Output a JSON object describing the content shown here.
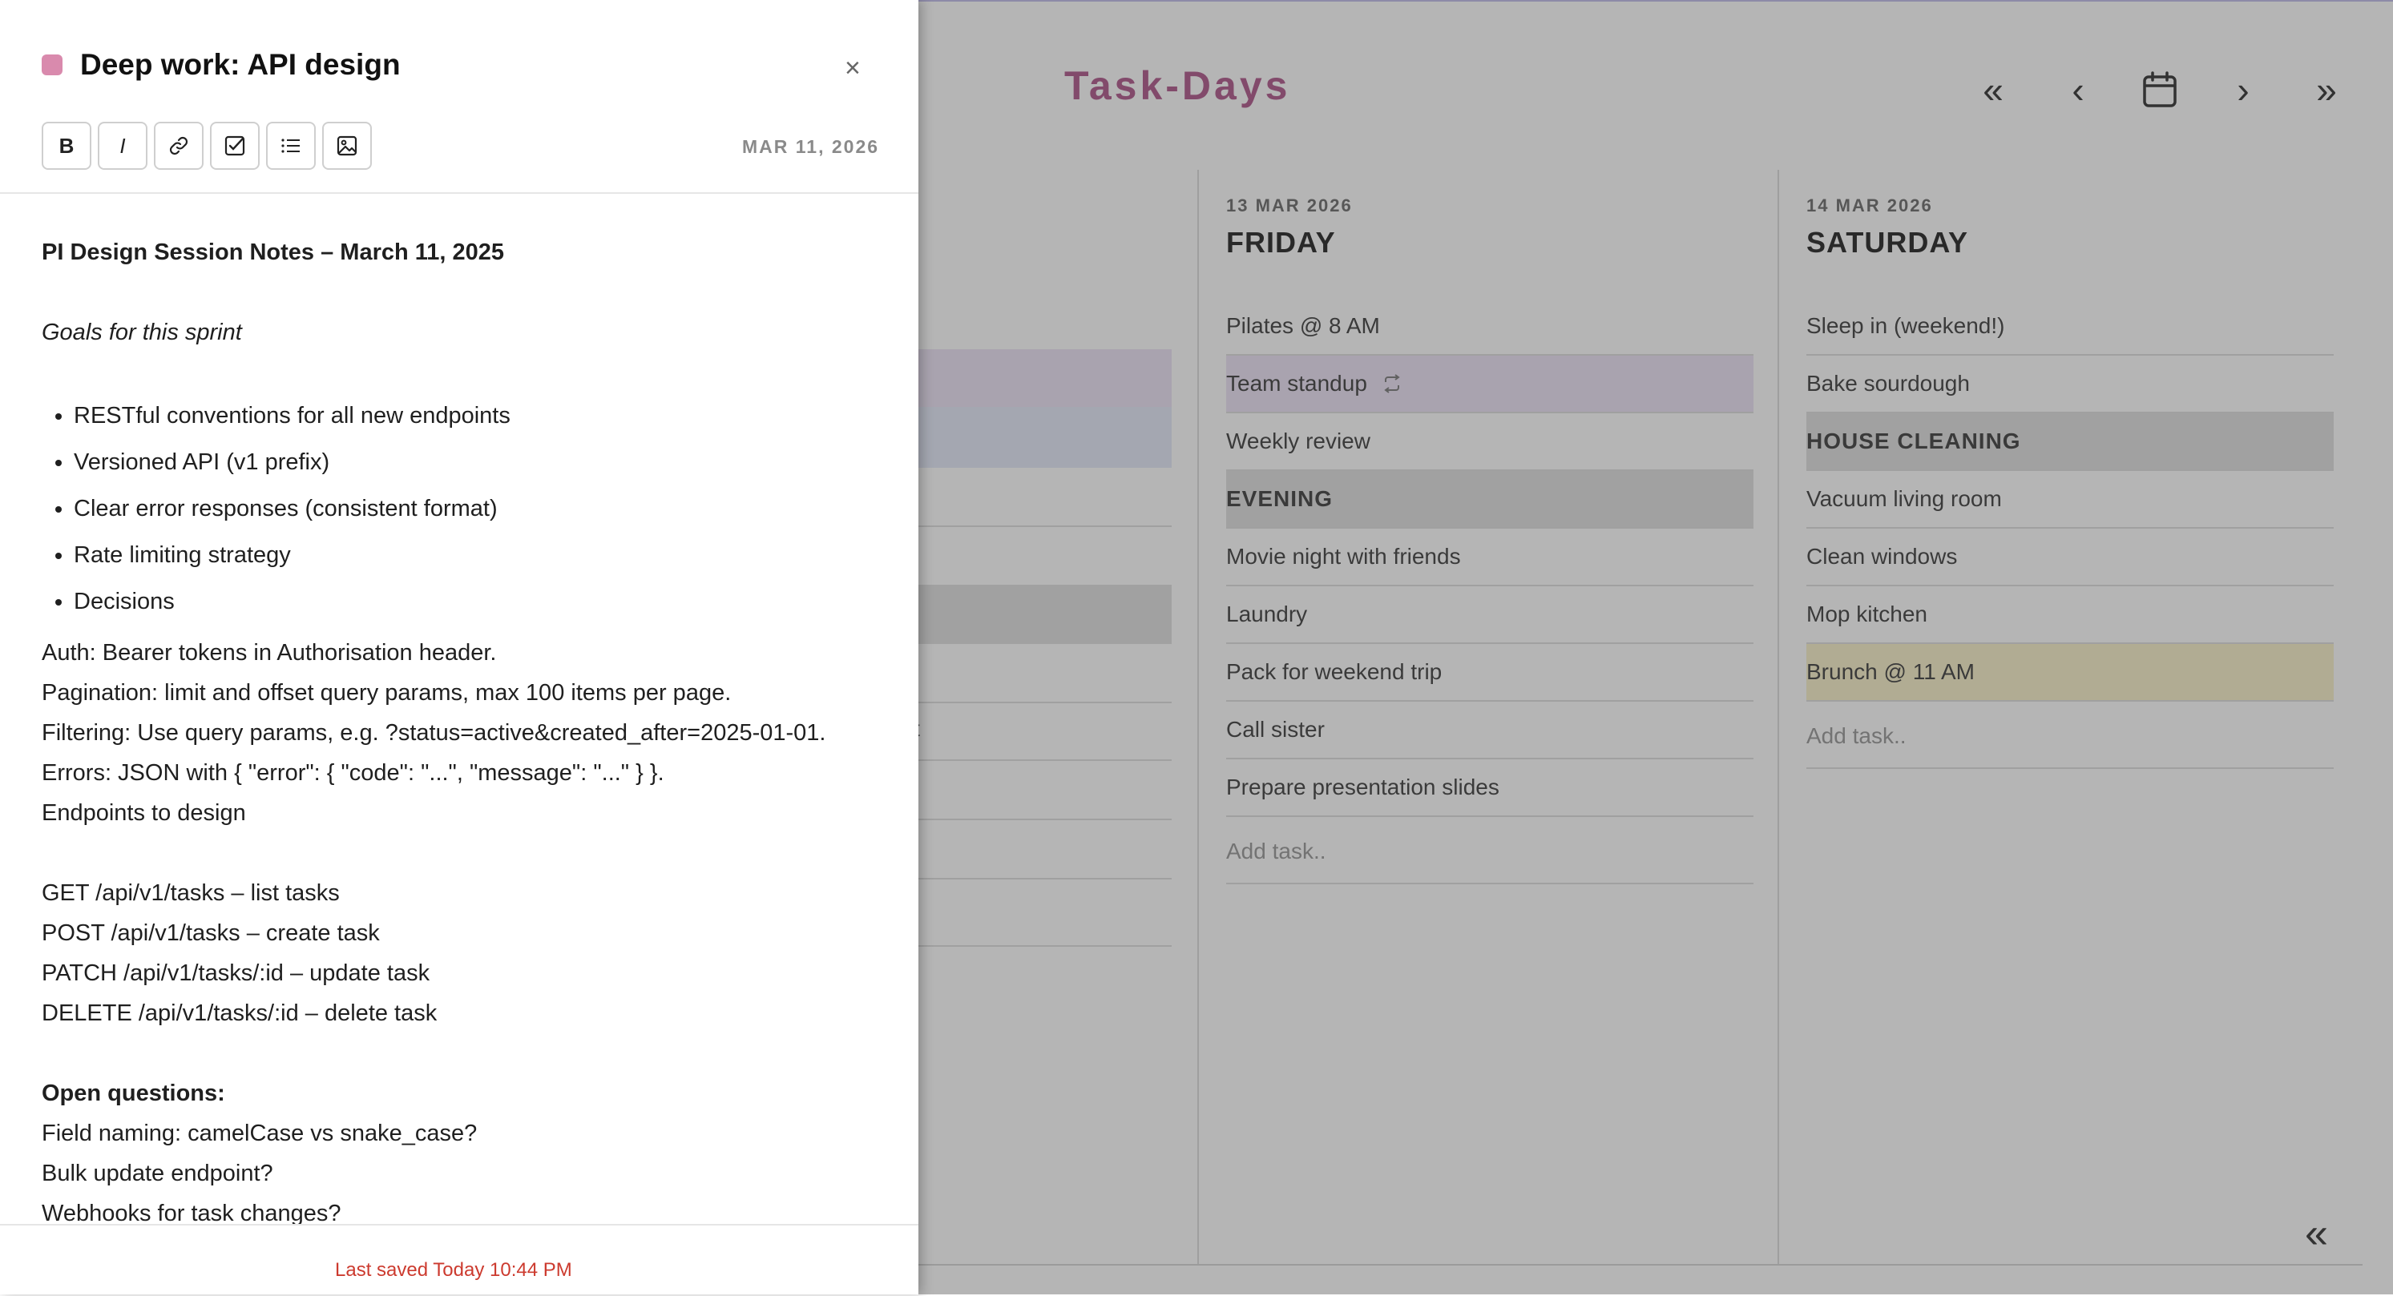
{
  "app": {
    "title": "Task-Days",
    "nav": {
      "prev_week": "«",
      "prev_day": "‹",
      "next_day": "›",
      "next_week": "»"
    },
    "collapse_label": "«",
    "previous_column_fragment": "t",
    "days": [
      {
        "date": "13 MAR 2026",
        "name": "FRIDAY",
        "tasks": [
          {
            "label": "Pilates @ 8 AM"
          },
          {
            "label": "Team standup"
          },
          {
            "label": "Weekly review"
          },
          {
            "label": "EVENING"
          },
          {
            "label": "Movie night with friends"
          },
          {
            "label": "Laundry"
          },
          {
            "label": "Pack for weekend trip"
          },
          {
            "label": "Call sister"
          },
          {
            "label": "Prepare presentation slides"
          }
        ],
        "add_placeholder": "Add task.."
      },
      {
        "date": "14 MAR 2026",
        "name": "SATURDAY",
        "tasks": [
          {
            "label": "Sleep in (weekend!)"
          },
          {
            "label": "Bake sourdough"
          },
          {
            "label": "HOUSE CLEANING"
          },
          {
            "label": "Vacuum living room"
          },
          {
            "label": "Clean windows"
          },
          {
            "label": "Mop kitchen"
          },
          {
            "label": "Brunch @ 11 AM"
          }
        ],
        "add_placeholder": "Add task.."
      }
    ]
  },
  "panel": {
    "title": "Deep work: API design",
    "close_label": "×",
    "date": "MAR 11, 2026",
    "toolbar": {
      "bold": "B",
      "italic": "I"
    },
    "body": {
      "heading": "PI Design Session Notes – March 11, 2025",
      "goals": "Goals for this sprint",
      "bullets": [
        "RESTful conventions for all new endpoints",
        "Versioned API (v1 prefix)",
        "Clear error responses (consistent format)",
        "Rate limiting strategy",
        "Decisions"
      ],
      "decisions": [
        "Auth: Bearer tokens in Authorisation header.",
        "Pagination: limit and offset query params, max 100 items per page.",
        "Filtering: Use query params, e.g. ?status=active&created_after=2025-01-01.",
        "Errors: JSON with { \"error\": { \"code\": \"...\", \"message\": \"...\" } }.",
        "Endpoints to design"
      ],
      "endpoints": [
        "GET /api/v1/tasks – list tasks",
        "POST /api/v1/tasks – create task",
        "PATCH /api/v1/tasks/:id – update task",
        "DELETE /api/v1/tasks/:id – delete task"
      ],
      "open_questions_heading": "Open questions:",
      "open_questions": [
        "Field naming: camelCase vs snake_case?",
        "Bulk update endpoint?",
        "Webhooks for task changes?"
      ]
    },
    "saved_status": "Last saved Today 10:44 PM"
  },
  "colors": {
    "brand": "#a23c78",
    "note_dot": "#d98aad",
    "saved_text": "#cc3a2e"
  }
}
